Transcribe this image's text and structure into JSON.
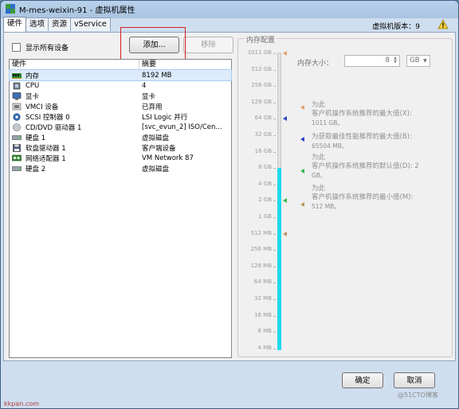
{
  "window": {
    "title": "M-mes-weixin-91 - 虚拟机属性"
  },
  "tabs": [
    {
      "label": "硬件",
      "active": true
    },
    {
      "label": "选项",
      "active": false
    },
    {
      "label": "资源",
      "active": false
    },
    {
      "label": "vService",
      "active": false
    }
  ],
  "version_label": "虚拟机版本：9",
  "show_all_devices": "显示所有设备",
  "buttons": {
    "add": "添加...",
    "remove": "移除",
    "ok": "确定",
    "cancel": "取消"
  },
  "hardware_list": {
    "headers": [
      "硬件",
      "摘要"
    ],
    "rows": [
      {
        "name": "内存",
        "summary": "8192 MB",
        "icon": "memory-icon",
        "selected": true
      },
      {
        "name": "CPU",
        "summary": "4",
        "icon": "cpu-icon"
      },
      {
        "name": "显卡",
        "summary": "显卡",
        "icon": "display-icon"
      },
      {
        "name": "VMCI 设备",
        "summary": "已弃用",
        "icon": "vmci-icon"
      },
      {
        "name": "SCSI 控制器 0",
        "summary": "LSI Logic 并行",
        "icon": "scsi-icon"
      },
      {
        "name": "CD/DVD 驱动器 1",
        "summary": "[svc_evun_2] ISO/Cen...",
        "icon": "cdrom-icon"
      },
      {
        "name": "硬盘 1",
        "summary": "虚拟磁盘",
        "icon": "disk-icon"
      },
      {
        "name": "软盘驱动器 1",
        "summary": "客户端设备",
        "icon": "floppy-icon"
      },
      {
        "name": "网络适配器 1",
        "summary": "VM Network 87",
        "icon": "network-icon"
      },
      {
        "name": "硬盘 2",
        "summary": "虚拟磁盘",
        "icon": "disk-icon"
      }
    ]
  },
  "memory_config": {
    "title": "内存配置",
    "size_label": "内存大小：",
    "size_value": "8",
    "unit": "GB",
    "scale_labels": [
      "1011 GB",
      "512 GB",
      "256 GB",
      "128 GB",
      "64 GB",
      "32 GB",
      "16 GB",
      "8 GB",
      "4 GB",
      "2 GB",
      "1 GB",
      "512 MB",
      "256 MB",
      "128 MB",
      "64 MB",
      "32 MB",
      "16 MB",
      "8 MB",
      "4 MB"
    ],
    "current_level": "8 GB",
    "hints": [
      {
        "line1": "为此",
        "line2": "客户机操作系统推荐的最大值(X):",
        "value": "1011 GB。",
        "color": "#e0a070"
      },
      {
        "line1": "为获取最佳性能推荐的最大值(B):",
        "line2": "",
        "value": "65504 MB。",
        "color": "#2c3fc9"
      },
      {
        "line1": "为此",
        "line2": "客户机操作系统推荐的默认值(D): 2",
        "value": "GB。",
        "color": "#36b64a"
      },
      {
        "line1": "为此",
        "line2": "客户机操作系统推荐的最小值(M):",
        "value": "512 MB。",
        "color": "#b89560"
      }
    ]
  },
  "watermarks": {
    "left": "kkpan.com",
    "right": "@51CTO博客"
  },
  "colors": {
    "bar": "#20d8ec",
    "selection": "#dcebfc",
    "highlight_box": "#d42020"
  }
}
